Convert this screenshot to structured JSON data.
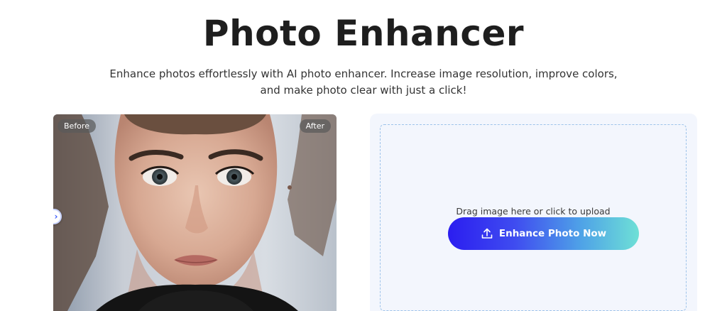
{
  "header": {
    "title": "Photo Enhancer",
    "subtitle": "Enhance photos effortlessly with AI photo enhancer. Increase image resolution, improve colors, and make photo clear with just a click!"
  },
  "compare": {
    "before_label": "Before",
    "after_label": "After",
    "handle_icon": "chevron-right-icon"
  },
  "upload": {
    "drop_text": "Drag image here or click to upload",
    "button_label": "Enhance Photo Now",
    "button_icon": "upload-icon",
    "accent_start": "#2b1df0",
    "accent_end": "#6ee0d6"
  }
}
